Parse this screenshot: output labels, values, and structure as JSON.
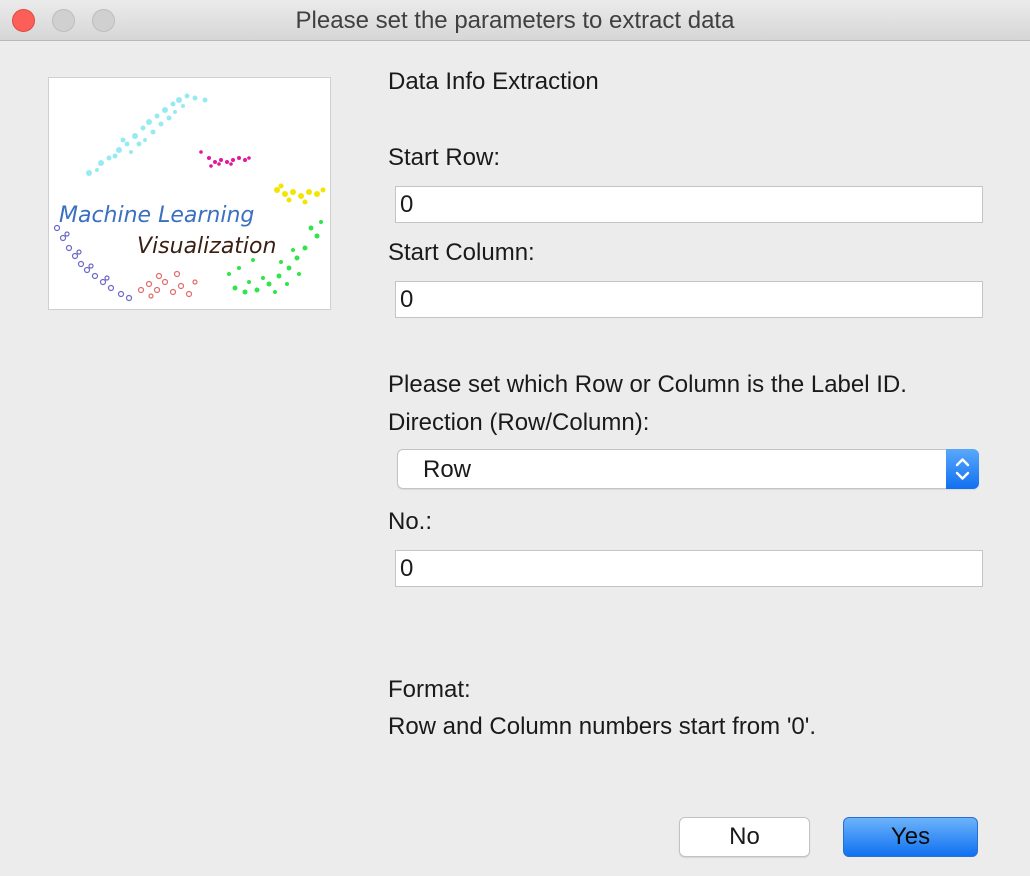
{
  "window": {
    "title": "Please set the parameters to extract data"
  },
  "logo": {
    "line1": "Machine Learning",
    "line2": "Visualization"
  },
  "form": {
    "heading": "Data Info Extraction",
    "start_row_label": "Start Row:",
    "start_row_value": "0",
    "start_column_label": "Start Column:",
    "start_column_value": "0",
    "label_id_prompt": "Please set which Row or Column is the Label ID.",
    "direction_label": "Direction (Row/Column):",
    "direction_value": "Row",
    "no_label": "No.:",
    "no_value": "0",
    "format_title": "Format:",
    "format_text": "Row and Column numbers start from '0'."
  },
  "buttons": {
    "no_label": "No",
    "yes_label": "Yes"
  },
  "colors": {
    "close": "#fc5f57",
    "accent": "#1170f1",
    "logo_line1": "#3a6fc2",
    "logo_line2": "#3a1f12"
  },
  "icons": {
    "select_arrows": "chevron-up-down-icon"
  }
}
